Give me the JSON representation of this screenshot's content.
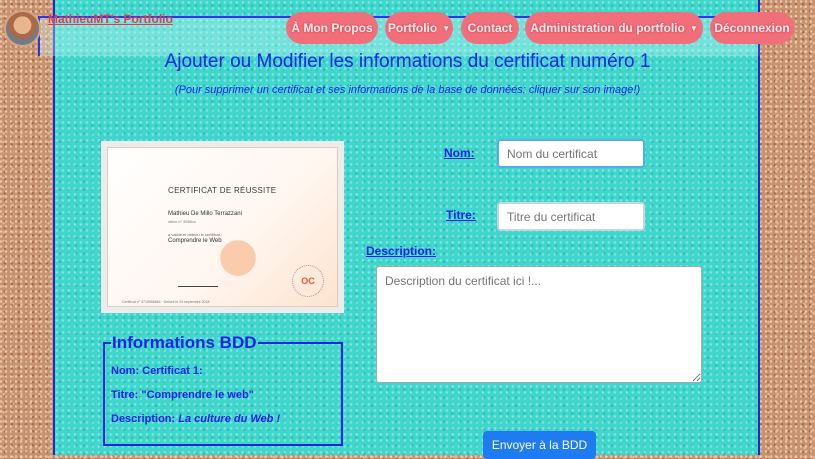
{
  "navbar": {
    "brand": "MathieuMT's Portfolio",
    "items": [
      {
        "label": "À Mon Propos"
      },
      {
        "label": "Portfolio"
      },
      {
        "label": "Contact"
      },
      {
        "label": "Administration du portfolio"
      },
      {
        "label": "Déconnexion"
      }
    ]
  },
  "main": {
    "title": "Ajouter ou Modifier les informations du certificat numéro 1",
    "subtitle": "(Pour supprimer un certificat et ses informations de la base de données: cliquer sur son image!)"
  },
  "certificate_image": {
    "title": "CERTIFICAT DE RÉUSSITE",
    "name": "Mathieu De Millo Terrazzani",
    "id": "cblxx n° 3556xx",
    "line": "a validé et obtenu le certificat :",
    "course": "Comprendre le Web",
    "logo": "OC",
    "footer": "Certificat n° 4715568664 · Délivré le 24 septembre 2018"
  },
  "info_bdd": {
    "legend": "Informations BDD",
    "nom_label": "Nom:",
    "nom_value": "Certificat 1:",
    "titre_label": "Titre:",
    "titre_value": "\"Comprendre le web\"",
    "description_label": "Description:",
    "description_value": "La culture du Web !"
  },
  "form": {
    "nom_label": "Nom:",
    "nom_placeholder": "Nom du certificat",
    "titre_label": "Titre:",
    "titre_placeholder": "Titre du certificat",
    "description_label": "Description:",
    "description_placeholder": "Description du certificat ici !...",
    "submit_label": "Envoyer à la BDD"
  },
  "colors": {
    "accent_blue": "#1a24e8",
    "nav_pill": "#f06f7b",
    "submit_button": "#1e7bf0"
  }
}
